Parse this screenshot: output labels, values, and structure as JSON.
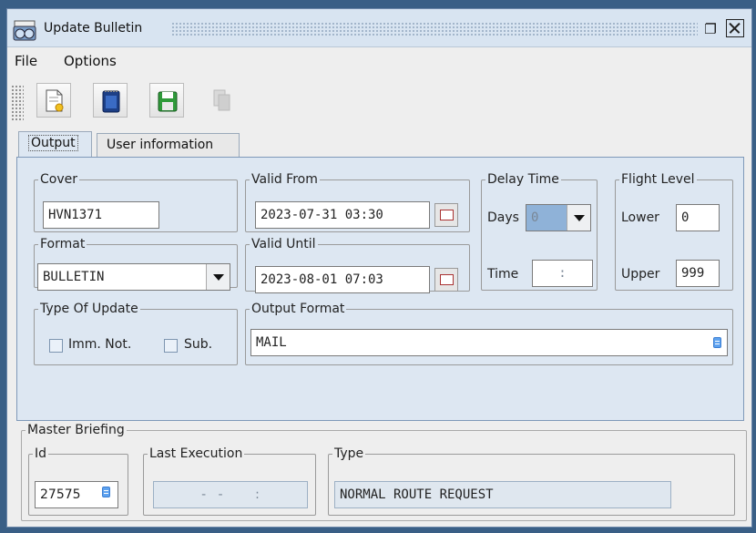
{
  "window": {
    "title": "Update Bulletin",
    "restore_glyph": "❐",
    "icons": [
      "app-icon",
      "restore-icon",
      "close-icon"
    ]
  },
  "menubar": {
    "file": "File",
    "options": "Options"
  },
  "toolbar": {
    "buttons": [
      {
        "name": "new-document-icon",
        "enabled": true
      },
      {
        "name": "notepad-icon",
        "enabled": true
      },
      {
        "name": "save-icon",
        "enabled": true
      },
      {
        "name": "copy-icon",
        "enabled": false
      }
    ]
  },
  "tabs": [
    {
      "label": "Output",
      "active": true
    },
    {
      "label": "User information",
      "active": false
    }
  ],
  "output": {
    "cover": {
      "legend": "Cover",
      "value": "HVN1371"
    },
    "format": {
      "legend": "Format",
      "value": "BULLETIN"
    },
    "valid_from": {
      "legend": "Valid From",
      "value": "2023-07-31 03:30"
    },
    "valid_until": {
      "legend": "Valid Until",
      "value": "2023-08-01 07:03"
    },
    "delay_time": {
      "legend": "Delay Time",
      "days_label": "Days",
      "days_value": "0",
      "time_label": "Time",
      "time_value": ":"
    },
    "flight_level": {
      "legend": "Flight Level",
      "lower_label": "Lower",
      "lower_value": "0",
      "upper_label": "Upper",
      "upper_value": "999"
    },
    "type_of_update": {
      "legend": "Type Of Update",
      "imm_not_label": "Imm. Not.",
      "imm_not_checked": false,
      "sub_label": "Sub.",
      "sub_checked": false
    },
    "output_format": {
      "legend": "Output Format",
      "value": "MAIL"
    }
  },
  "master_briefing": {
    "legend": "Master Briefing",
    "id": {
      "legend": "Id",
      "value": "27575"
    },
    "last_execution": {
      "legend": "Last Execution",
      "value": "-   -        :"
    },
    "type": {
      "legend": "Type",
      "value": "NORMAL ROUTE REQUEST"
    }
  },
  "colors": {
    "background": "#3a5f86",
    "panel": "#dde7f2",
    "titlebar": "#d8e4f1",
    "combo_highlight": "#8fb2d8",
    "db_icon": "#5ea2ef"
  }
}
